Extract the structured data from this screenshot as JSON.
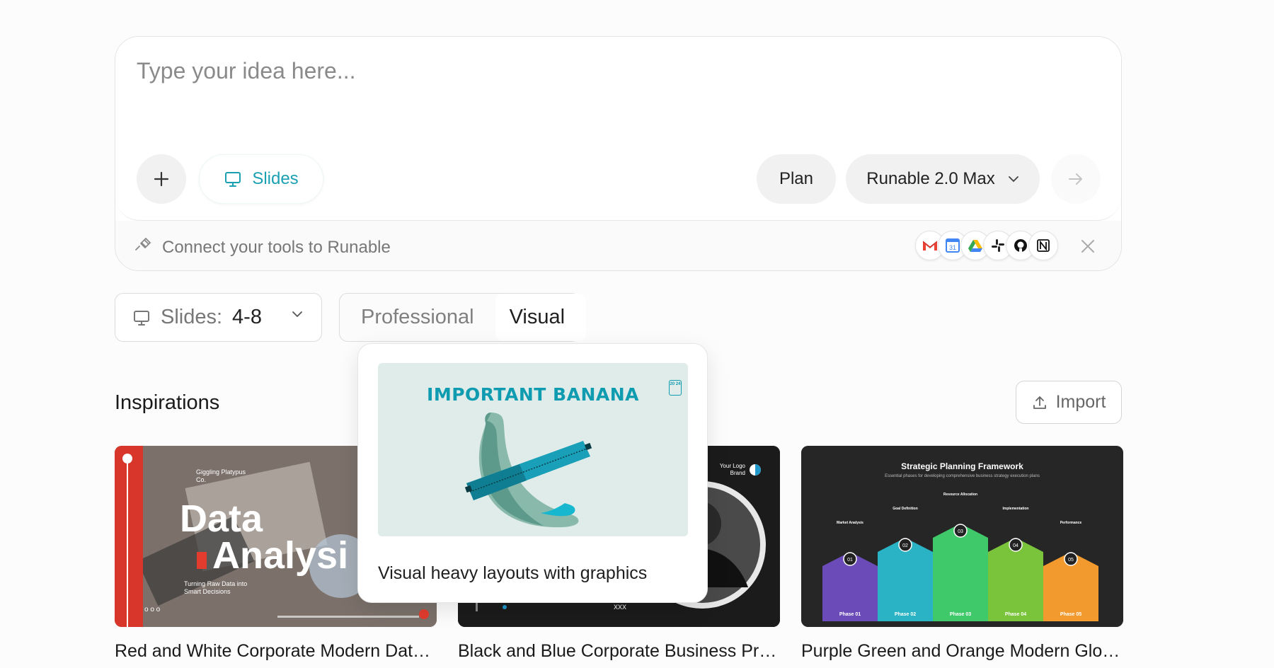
{
  "composer": {
    "placeholder": "Type your idea here...",
    "slides_chip": "Slides",
    "plan_label": "Plan",
    "model_label": "Runable 2.0 Max",
    "connect_text": "Connect your tools to Runable",
    "tools": [
      "gmail-icon",
      "google-calendar-icon",
      "google-drive-icon",
      "slack-icon",
      "github-icon",
      "notion-icon"
    ]
  },
  "options": {
    "slides_label": "Slides:",
    "slides_value": "4-8",
    "style_options": [
      "Professional",
      "Visual"
    ],
    "style_selected": "Visual"
  },
  "popover": {
    "preview_title": "IMPORTANT BANANA",
    "preview_badge": "20 24",
    "description": "Visual heavy layouts with graphics"
  },
  "inspirations": {
    "title": "Inspirations",
    "import_label": "Import",
    "cards": [
      {
        "caption": "Red and White Corporate Modern Data ...",
        "brand": "Giggling Platypus Co.",
        "headline_1": "Data",
        "headline_2": "Analysi",
        "subtitle": "Turning Raw Data into Smart Decisions",
        "dots": "o o o"
      },
      {
        "caption": "Black and Blue Corporate Business Pres...",
        "logo": "Your Logo Brand",
        "footer": "xxx"
      },
      {
        "caption": "Purple Green and Orange Modern Globa...",
        "title": "Strategic Planning Framework",
        "subtitle": "Essential phases for developing comprehensive business strategy execution plans",
        "phases": [
          {
            "num": "01",
            "label": "Phase 01",
            "heading": "Market Analysis",
            "color": "#6a4bb8"
          },
          {
            "num": "02",
            "label": "Phase 02",
            "heading": "Goal Definition",
            "color": "#2ab3c4"
          },
          {
            "num": "03",
            "label": "Phase 03",
            "heading": "Resource Allocation",
            "color": "#3fc96a"
          },
          {
            "num": "04",
            "label": "Phase 04",
            "heading": "Implementation",
            "color": "#79c43a"
          },
          {
            "num": "05",
            "label": "Phase 05",
            "heading": "Performance",
            "color": "#f29a2e"
          }
        ]
      }
    ]
  }
}
